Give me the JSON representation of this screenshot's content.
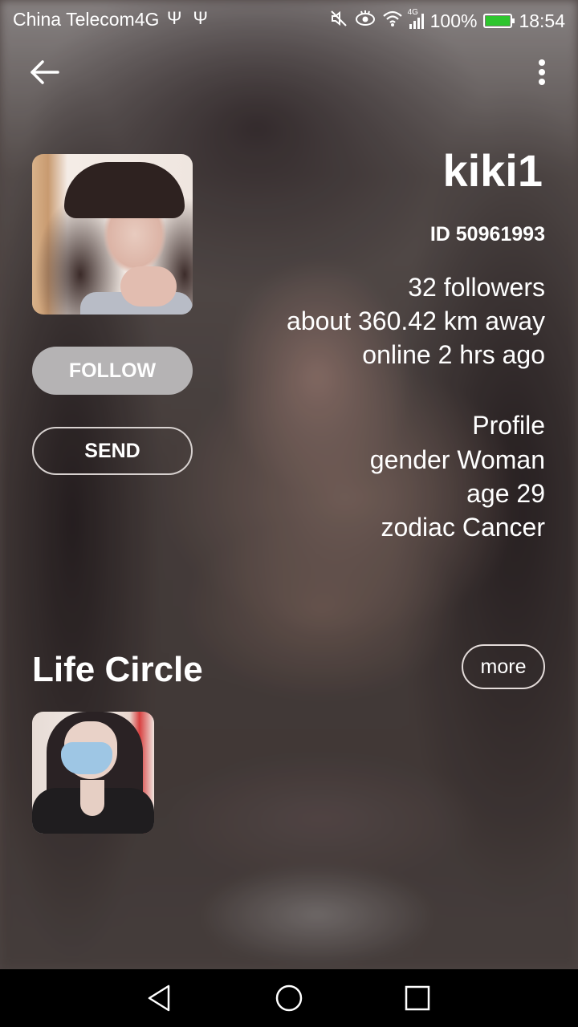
{
  "status_bar": {
    "carrier": "China Telecom4G",
    "usb_icons": "Ψ Ψ",
    "network": "4G",
    "battery": "100%",
    "time": "18:54"
  },
  "icons": {
    "back": "back-arrow-icon",
    "menu": "more-vertical-icon",
    "mute": "mute-icon",
    "eye": "eye-comfort-icon",
    "wifi": "wifi-icon",
    "signal": "signal-icon",
    "battery": "battery-charging-icon",
    "nav_back": "nav-back-icon",
    "nav_home": "nav-home-icon",
    "nav_recent": "nav-recent-icon"
  },
  "profile": {
    "username": "kiki1",
    "id_text": "ID 50961993",
    "followers": "32 followers",
    "distance": "about 360.42 km away",
    "online": "online 2 hrs ago",
    "section_label": "Profile",
    "gender": "gender Woman",
    "age": "age 29",
    "zodiac": "zodiac Cancer"
  },
  "actions": {
    "follow_label": "FOLLOW",
    "send_label": "SEND"
  },
  "life_circle": {
    "title": "Life Circle",
    "more_label": "more"
  },
  "colors": {
    "follow_button_bg": "#b5b3b4",
    "battery_fill": "#2ec52e",
    "nav_bar_bg": "#000000"
  }
}
